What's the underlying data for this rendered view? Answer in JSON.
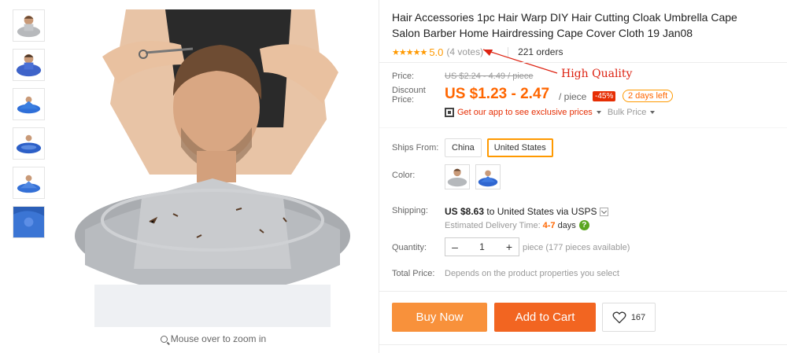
{
  "product": {
    "title": "Hair Accessories 1pc Hair Warp DIY Hair Cutting Cloak Umbrella Cape Salon Barber Home Hairdressing Cape Cover Cloth 19 Jan08",
    "rating_score": "5.0",
    "votes": "(4 votes)",
    "orders": "221 orders",
    "stars": "★★★★★"
  },
  "annotation": {
    "text": "High Quality",
    "color": "#dd2211"
  },
  "price": {
    "price_label": "Price:",
    "old_price": "US $2.24 - 4.49 / piece",
    "discount_label": "Discount Price:",
    "discount_price": "US $1.23 - 2.47",
    "per_piece": "/ piece",
    "discount_pct": "-45%",
    "days_left": "2 days left",
    "app_text": "Get our app to see exclusive prices",
    "bulk_price": "Bulk Price"
  },
  "ships_from": {
    "label": "Ships From:",
    "options": [
      "China",
      "United States"
    ],
    "selected": "United States"
  },
  "color": {
    "label": "Color:",
    "swatches": [
      "hair-cape-gray",
      "hair-cape-blue"
    ]
  },
  "shipping": {
    "label": "Shipping:",
    "cost": "US $8.63",
    "to_text": "to United States via USPS",
    "est_label": "Estimated Delivery Time:",
    "days": "4-7",
    "days_unit": "days",
    "help": "?"
  },
  "quantity": {
    "label": "Quantity:",
    "minus": "–",
    "value": "1",
    "plus": "+",
    "available": "piece (177 pieces available)"
  },
  "total": {
    "label": "Total Price:",
    "value": "Depends on the product properties you select"
  },
  "actions": {
    "buy_now": "Buy Now",
    "add_to_cart": "Add to Cart",
    "wishlist_count": "167"
  },
  "gallery": {
    "zoom_hint": "Mouse over to zoom in"
  },
  "colors": {
    "accent": "#ff6600",
    "buy_now": "#f8913b",
    "add_to_cart": "#f26521",
    "star": "#ff9900",
    "discount_badge": "#e62e04"
  }
}
